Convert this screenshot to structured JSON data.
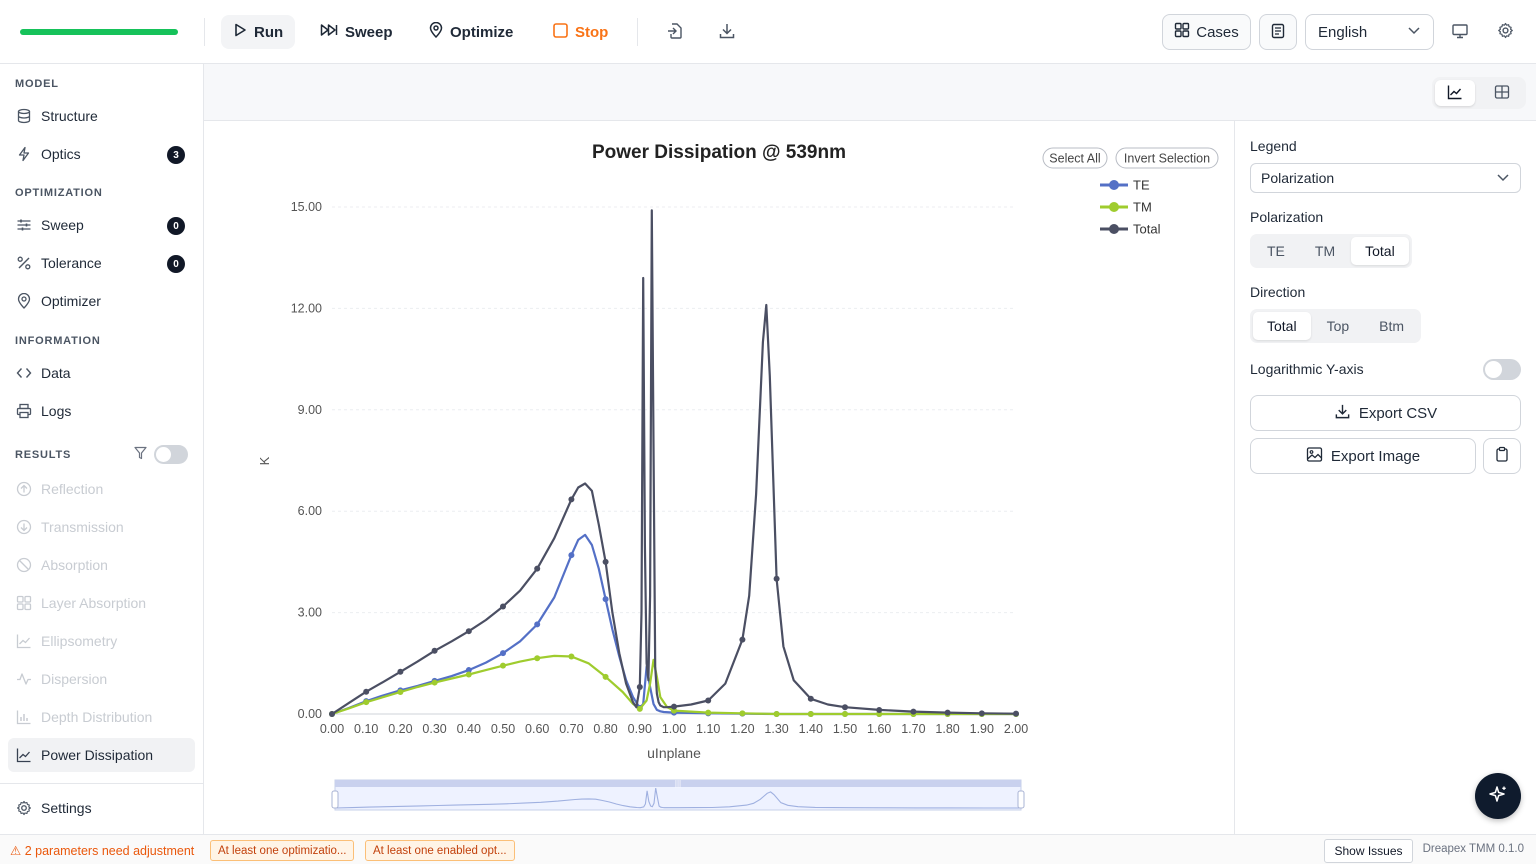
{
  "toolbar": {
    "progress": 1.0,
    "run_label": "Run",
    "sweep_label": "Sweep",
    "optimize_label": "Optimize",
    "stop_label": "Stop",
    "cases_label": "Cases",
    "language": "English"
  },
  "sidebar": {
    "model_title": "MODEL",
    "structure": "Structure",
    "optics": "Optics",
    "optics_count": "3",
    "optimization_title": "OPTIMIZATION",
    "sweep": "Sweep",
    "sweep_count": "0",
    "tolerance": "Tolerance",
    "tolerance_count": "0",
    "optimizer": "Optimizer",
    "information_title": "INFORMATION",
    "data": "Data",
    "logs": "Logs",
    "results_title": "RESULTS",
    "results": [
      "Reflection",
      "Transmission",
      "Absorption",
      "Layer Absorption",
      "Ellipsometry",
      "Dispersion",
      "Depth Distribution",
      "Power Dissipation"
    ],
    "settings": "Settings"
  },
  "right_panel": {
    "legend_label": "Legend",
    "legend_value": "Polarization",
    "polarization_label": "Polarization",
    "polarization_options": [
      "TE",
      "TM",
      "Total"
    ],
    "polarization_selected": "Total",
    "direction_label": "Direction",
    "direction_options": [
      "Total",
      "Top",
      "Btm"
    ],
    "direction_selected": "Total",
    "log_y_label": "Logarithmic Y-axis",
    "export_csv": "Export CSV",
    "export_image": "Export Image"
  },
  "chart_controls": {
    "select_all": "Select All",
    "invert_selection": "Invert Selection"
  },
  "chart_data": {
    "type": "line",
    "title": "Power Dissipation @ 539nm",
    "xlabel": "uInplane",
    "ylabel": "K",
    "xlim": [
      0,
      2.0
    ],
    "ylim": [
      0,
      15.0
    ],
    "x_ticks": [
      "0.00",
      "0.10",
      "0.20",
      "0.30",
      "0.40",
      "0.50",
      "0.60",
      "0.70",
      "0.80",
      "0.90",
      "1.00",
      "1.10",
      "1.20",
      "1.30",
      "1.40",
      "1.50",
      "1.60",
      "1.70",
      "1.80",
      "1.90",
      "2.00"
    ],
    "y_ticks": [
      "0.00",
      "3.00",
      "6.00",
      "9.00",
      "12.00",
      "15.00"
    ],
    "legend_position": "top-right",
    "grid": true,
    "series": [
      {
        "name": "TE",
        "color": "#5470c6",
        "x": [
          0,
          0.05,
          0.1,
          0.15,
          0.2,
          0.25,
          0.3,
          0.35,
          0.4,
          0.45,
          0.5,
          0.55,
          0.6,
          0.65,
          0.7,
          0.72,
          0.74,
          0.76,
          0.78,
          0.8,
          0.82,
          0.84,
          0.86,
          0.88,
          0.9,
          0.91,
          0.92,
          0.93,
          0.94,
          0.95,
          0.96,
          0.97,
          1.0,
          1.1,
          1.2,
          1.3,
          1.4,
          1.5,
          1.6,
          1.7,
          1.8,
          1.9,
          2.0
        ],
        "y": [
          0,
          0.18,
          0.38,
          0.55,
          0.7,
          0.83,
          0.98,
          1.12,
          1.3,
          1.52,
          1.8,
          2.15,
          2.65,
          3.45,
          4.7,
          5.15,
          5.3,
          5.0,
          4.3,
          3.4,
          2.5,
          1.7,
          1.0,
          0.5,
          0.18,
          0.3,
          1.4,
          0.8,
          0.3,
          0.12,
          0.08,
          0.06,
          0.04,
          0.02,
          0.01,
          0.0,
          0.0,
          0.0,
          0.0,
          0.0,
          0.0,
          0.0,
          0.0
        ],
        "markers_x": [
          0,
          0.1,
          0.2,
          0.3,
          0.4,
          0.5,
          0.6,
          0.7,
          0.8,
          0.9,
          1.0,
          1.1,
          1.2,
          1.3,
          1.4,
          1.5,
          1.6,
          1.7,
          1.8,
          1.9,
          2.0
        ]
      },
      {
        "name": "TM",
        "color": "#9fcc2e",
        "x": [
          0,
          0.05,
          0.1,
          0.15,
          0.2,
          0.25,
          0.3,
          0.35,
          0.4,
          0.45,
          0.5,
          0.55,
          0.6,
          0.65,
          0.7,
          0.75,
          0.8,
          0.85,
          0.88,
          0.9,
          0.92,
          0.93,
          0.94,
          0.95,
          0.96,
          0.98,
          1.0,
          1.1,
          1.2,
          1.3,
          1.4,
          1.5,
          1.6,
          1.7,
          1.8,
          1.9,
          2.0
        ],
        "y": [
          0,
          0.17,
          0.35,
          0.5,
          0.65,
          0.8,
          0.93,
          1.05,
          1.17,
          1.3,
          1.43,
          1.55,
          1.65,
          1.72,
          1.7,
          1.5,
          1.1,
          0.65,
          0.3,
          0.15,
          0.4,
          0.9,
          1.6,
          1.1,
          0.5,
          0.2,
          0.1,
          0.04,
          0.02,
          0.0,
          0.0,
          0.0,
          0.0,
          0.0,
          0.0,
          0.0,
          0.0
        ],
        "markers_x": [
          0,
          0.1,
          0.2,
          0.3,
          0.4,
          0.5,
          0.6,
          0.7,
          0.8,
          0.9,
          1.0,
          1.1,
          1.2,
          1.3,
          1.4,
          1.5,
          1.6,
          1.7,
          1.8,
          1.9,
          2.0
        ]
      },
      {
        "name": "Total",
        "color": "#4b4f63",
        "x": [
          0,
          0.05,
          0.1,
          0.15,
          0.2,
          0.25,
          0.3,
          0.35,
          0.4,
          0.45,
          0.5,
          0.55,
          0.6,
          0.65,
          0.7,
          0.72,
          0.74,
          0.76,
          0.78,
          0.8,
          0.82,
          0.84,
          0.86,
          0.88,
          0.89,
          0.9,
          0.905,
          0.91,
          0.915,
          0.92,
          0.925,
          0.93,
          0.935,
          0.94,
          0.945,
          0.95,
          0.955,
          0.96,
          0.97,
          0.98,
          1.0,
          1.05,
          1.1,
          1.15,
          1.2,
          1.22,
          1.24,
          1.26,
          1.27,
          1.28,
          1.3,
          1.32,
          1.35,
          1.4,
          1.45,
          1.5,
          1.6,
          1.7,
          1.8,
          1.9,
          2.0
        ],
        "y": [
          0,
          0.33,
          0.66,
          0.95,
          1.25,
          1.55,
          1.87,
          2.15,
          2.45,
          2.78,
          3.18,
          3.65,
          4.3,
          5.2,
          6.35,
          6.7,
          6.82,
          6.6,
          5.6,
          4.5,
          3.0,
          1.8,
          0.9,
          0.35,
          0.2,
          0.8,
          3.0,
          12.9,
          5.0,
          1.5,
          1.0,
          3.5,
          14.9,
          8.0,
          1.4,
          0.6,
          0.35,
          0.25,
          0.2,
          0.2,
          0.22,
          0.28,
          0.4,
          0.9,
          2.2,
          3.5,
          6.5,
          11.0,
          12.1,
          10.0,
          4.0,
          2.0,
          1.0,
          0.45,
          0.28,
          0.2,
          0.12,
          0.07,
          0.04,
          0.02,
          0.01
        ],
        "markers_x": [
          0,
          0.1,
          0.2,
          0.3,
          0.4,
          0.5,
          0.6,
          0.7,
          0.8,
          0.9,
          1.0,
          1.1,
          1.2,
          1.3,
          1.4,
          1.5,
          1.6,
          1.7,
          1.8,
          1.9,
          2.0
        ]
      }
    ]
  },
  "status": {
    "warning": "2 parameters need adjustment",
    "chip1": "At least one optimizatio...",
    "chip2": "At least one enabled opt...",
    "show_issues": "Show Issues",
    "version": "Dreapex TMM 0.1.0"
  }
}
